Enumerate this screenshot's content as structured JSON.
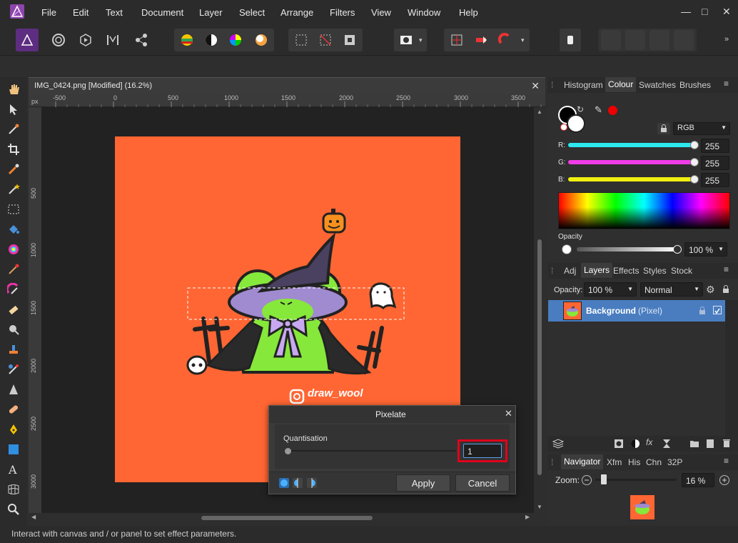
{
  "menu": {
    "items": [
      "File",
      "Edit",
      "Text",
      "Document",
      "Layer",
      "Select",
      "Arrange",
      "Filters",
      "View",
      "Window",
      "Help"
    ],
    "minimize": "—",
    "maximize": "□",
    "close": "✕"
  },
  "document": {
    "tab_title": "IMG_0424.png [Modified] (16.2%)",
    "close": "✕",
    "ruler_unit": "px",
    "ruler_h": [
      "-500",
      "0",
      "500",
      "1000",
      "1500",
      "2000",
      "2500",
      "3000",
      "3500"
    ],
    "ruler_v": [
      "500",
      "1000",
      "1500",
      "2000",
      "2500",
      "3000"
    ],
    "watermark": "draw_wool"
  },
  "colour_panel": {
    "tabs": [
      "Histogram",
      "Colour",
      "Swatches",
      "Brushes"
    ],
    "active_tab": "Colour",
    "model": "RGB",
    "r_label": "R:",
    "r_value": "255",
    "g_label": "G:",
    "g_value": "255",
    "b_label": "B:",
    "b_value": "255",
    "opacity_label": "Opacity",
    "opacity_value": "100 %"
  },
  "layers_panel": {
    "tabs": [
      "Adj",
      "Layers",
      "Effects",
      "Styles",
      "Stock"
    ],
    "active_tab": "Layers",
    "opacity_label": "Opacity:",
    "opacity_value": "100 %",
    "blend_mode": "Normal",
    "layer_name": "Background",
    "layer_type": "(Pixel)"
  },
  "navigator_panel": {
    "tabs": [
      "Navigator",
      "Xfm",
      "His",
      "Chn",
      "32P"
    ],
    "active_tab": "Navigator",
    "zoom_label": "Zoom:",
    "zoom_value": "16 %"
  },
  "pixelate_dialog": {
    "title": "Pixelate",
    "param_label": "Quantisation",
    "param_value": "1",
    "apply": "Apply",
    "cancel": "Cancel",
    "close": "✕"
  },
  "status": {
    "text": "Interact with canvas and / or panel to set effect parameters."
  },
  "colors": {
    "accent": "#4a90d9",
    "artboard": "#ff6633",
    "highlight_red": "#e0001b",
    "layer_selected": "#4a7dc0"
  }
}
